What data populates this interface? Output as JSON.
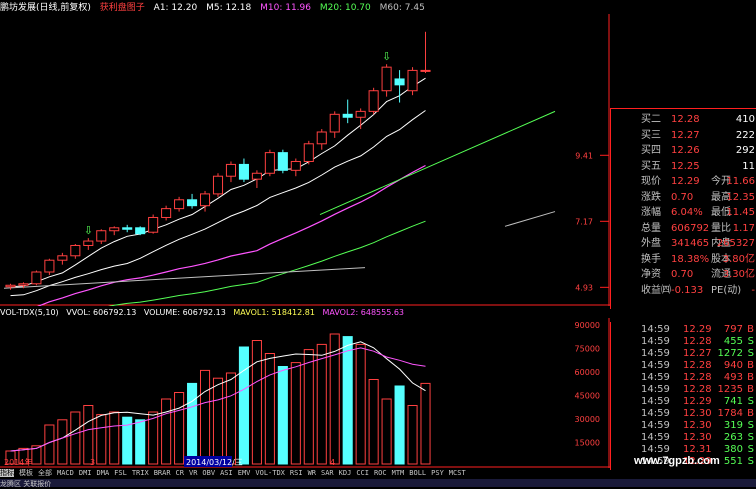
{
  "title_bar": {
    "stock": "鹏坊发展(日线,前复权)",
    "flag": "获利盘图子",
    "a1": "A1: 12.20",
    "m5": "M5: 12.18",
    "m10": "M10: 11.96",
    "m20": "M20: 10.70",
    "m60": "M60: 7.45"
  },
  "price_axis": {
    "p1": "9.41",
    "p2": "7.17",
    "p3": "4.93"
  },
  "vol_title": {
    "name": "VOL-TDX(5,10)",
    "vvol": "VVOL: 606792.13",
    "volume": "VOLUME: 606792.13",
    "mavol1": "MAVOL1: 518412.81",
    "mavol2": "MAVOL2: 648555.63"
  },
  "vol_axis": [
    "90000",
    "75000",
    "60000",
    "45000",
    "30000",
    "15000"
  ],
  "date_axis": {
    "start": "2014年",
    "m3": "3",
    "cursor": "2014/03/12/三",
    "m4": "4"
  },
  "quote_panel": [
    {
      "label": "买二",
      "v1": "12.28",
      "l2": "",
      "v2": "410"
    },
    {
      "label": "买三",
      "v1": "12.27",
      "l2": "",
      "v2": "222"
    },
    {
      "label": "买四",
      "v1": "12.26",
      "l2": "",
      "v2": "292"
    },
    {
      "label": "买五",
      "v1": "12.25",
      "l2": "",
      "v2": "11"
    },
    {
      "label": "现价",
      "v1": "12.29",
      "l2": "今开",
      "v2": "11.66"
    },
    {
      "label": "涨跌",
      "v1": "0.70",
      "l2": "最高",
      "v2": "12.35"
    },
    {
      "label": "涨幅",
      "v1": "6.04%",
      "l2": "最低",
      "v2": "11.45"
    },
    {
      "label": "总量",
      "v1": "606792",
      "l2": "量比",
      "v2": "1.17"
    },
    {
      "label": "外盘",
      "v1": "341465",
      "l2": "内盘",
      "v2": "265327"
    },
    {
      "label": "换手",
      "v1": "18.38%",
      "l2": "股本",
      "v2": "3.80亿"
    },
    {
      "label": "净资",
      "v1": "0.70",
      "l2": "流通",
      "v2": "3.30亿"
    },
    {
      "label": "收益㈣",
      "v1": "-0.133",
      "l2": "PE(动)",
      "v2": "-"
    }
  ],
  "trades": [
    {
      "time": "14:59",
      "price": "12.29",
      "vol": "797",
      "dir": "B"
    },
    {
      "time": "14:59",
      "price": "12.28",
      "vol": "455",
      "dir": "S"
    },
    {
      "time": "14:59",
      "price": "12.27",
      "vol": "1272",
      "dir": "S"
    },
    {
      "time": "14:59",
      "price": "12.28",
      "vol": "940",
      "dir": "B"
    },
    {
      "time": "14:59",
      "price": "12.28",
      "vol": "493",
      "dir": "B"
    },
    {
      "time": "14:59",
      "price": "12.28",
      "vol": "1235",
      "dir": "B"
    },
    {
      "time": "14:59",
      "price": "12.29",
      "vol": "741",
      "dir": "S"
    },
    {
      "time": "14:59",
      "price": "12.30",
      "vol": "1784",
      "dir": "B"
    },
    {
      "time": "14:59",
      "price": "12.30",
      "vol": "319",
      "dir": "S"
    },
    {
      "time": "14:59",
      "price": "12.30",
      "vol": "263",
      "dir": "S"
    },
    {
      "time": "14:59",
      "price": "12.31",
      "vol": "380",
      "dir": "S"
    },
    {
      "time": "14:59",
      "price": "12.29",
      "vol": "551",
      "dir": "S"
    }
  ],
  "bottom_tabs": [
    "指标",
    "模板",
    "全部",
    "MACD",
    "DMI",
    "DMA",
    "FSL",
    "TRIX",
    "BRAR",
    "CR",
    "VR",
    "OBV",
    "ASI",
    "EMV",
    "VOL-TDX",
    "RSI",
    "WR",
    "SAR",
    "KDJ",
    "CCI",
    "ROC",
    "MTM",
    "BOLL",
    "PSY",
    "MCST"
  ],
  "status_text": "龙腾区 关联报价",
  "watermark": "www.7gpzb.com",
  "colors": {
    "up": "#ff4040",
    "down": "#55ffff",
    "ma5": "#ffffff",
    "ma10": "#ffff55",
    "ma20": "#ff55ff",
    "ma60": "#55ff55",
    "border": "#ff2020"
  },
  "chart_data": {
    "type": "candlestick",
    "candles": [
      {
        "o": 4.95,
        "h": 5.05,
        "l": 4.85,
        "c": 5.0
      },
      {
        "o": 5.0,
        "h": 5.1,
        "l": 4.9,
        "c": 5.05
      },
      {
        "o": 5.05,
        "h": 5.5,
        "l": 5.0,
        "c": 5.45
      },
      {
        "o": 5.45,
        "h": 5.9,
        "l": 5.35,
        "c": 5.85
      },
      {
        "o": 5.85,
        "h": 6.1,
        "l": 5.7,
        "c": 6.0
      },
      {
        "o": 6.0,
        "h": 6.4,
        "l": 5.9,
        "c": 6.35
      },
      {
        "o": 6.35,
        "h": 6.6,
        "l": 6.2,
        "c": 6.5
      },
      {
        "o": 6.5,
        "h": 6.9,
        "l": 6.4,
        "c": 6.85
      },
      {
        "o": 6.85,
        "h": 7.0,
        "l": 6.7,
        "c": 6.95
      },
      {
        "o": 6.95,
        "h": 7.05,
        "l": 6.8,
        "c": 6.9
      },
      {
        "o": 6.95,
        "h": 7.0,
        "l": 6.7,
        "c": 6.75
      },
      {
        "o": 6.8,
        "h": 7.4,
        "l": 6.75,
        "c": 7.3
      },
      {
        "o": 7.3,
        "h": 7.7,
        "l": 7.2,
        "c": 7.6
      },
      {
        "o": 7.6,
        "h": 8.0,
        "l": 7.5,
        "c": 7.9
      },
      {
        "o": 7.9,
        "h": 8.1,
        "l": 7.6,
        "c": 7.7
      },
      {
        "o": 7.7,
        "h": 8.2,
        "l": 7.5,
        "c": 8.1
      },
      {
        "o": 8.1,
        "h": 8.8,
        "l": 8.0,
        "c": 8.7
      },
      {
        "o": 8.7,
        "h": 9.2,
        "l": 8.5,
        "c": 9.1
      },
      {
        "o": 9.1,
        "h": 9.3,
        "l": 8.5,
        "c": 8.6
      },
      {
        "o": 8.6,
        "h": 8.9,
        "l": 8.3,
        "c": 8.8
      },
      {
        "o": 8.8,
        "h": 9.6,
        "l": 8.7,
        "c": 9.5
      },
      {
        "o": 9.5,
        "h": 9.6,
        "l": 8.8,
        "c": 8.9
      },
      {
        "o": 8.9,
        "h": 9.3,
        "l": 8.7,
        "c": 9.2
      },
      {
        "o": 9.2,
        "h": 9.9,
        "l": 9.1,
        "c": 9.8
      },
      {
        "o": 9.8,
        "h": 10.3,
        "l": 9.6,
        "c": 10.2
      },
      {
        "o": 10.2,
        "h": 10.9,
        "l": 10.0,
        "c": 10.8
      },
      {
        "o": 10.8,
        "h": 11.3,
        "l": 10.5,
        "c": 10.7
      },
      {
        "o": 10.7,
        "h": 11.0,
        "l": 10.3,
        "c": 10.9
      },
      {
        "o": 10.9,
        "h": 11.7,
        "l": 10.8,
        "c": 11.6
      },
      {
        "o": 11.6,
        "h": 12.5,
        "l": 11.4,
        "c": 12.4
      },
      {
        "o": 12.0,
        "h": 12.3,
        "l": 11.2,
        "c": 11.8
      },
      {
        "o": 11.6,
        "h": 12.4,
        "l": 11.45,
        "c": 12.29
      },
      {
        "o": 12.29,
        "h": 13.6,
        "l": 12.2,
        "c": 12.29
      }
    ],
    "volume": [
      10,
      12,
      14,
      30,
      34,
      40,
      45,
      38,
      40,
      36,
      34,
      40,
      50,
      55,
      62,
      72,
      66,
      70,
      90,
      95,
      85,
      75,
      78,
      88,
      92,
      100,
      98,
      92,
      65,
      50,
      60,
      45,
      62
    ],
    "signals": [
      {
        "index": 6,
        "label": "B"
      },
      {
        "index": 29,
        "label": "B"
      }
    ]
  }
}
